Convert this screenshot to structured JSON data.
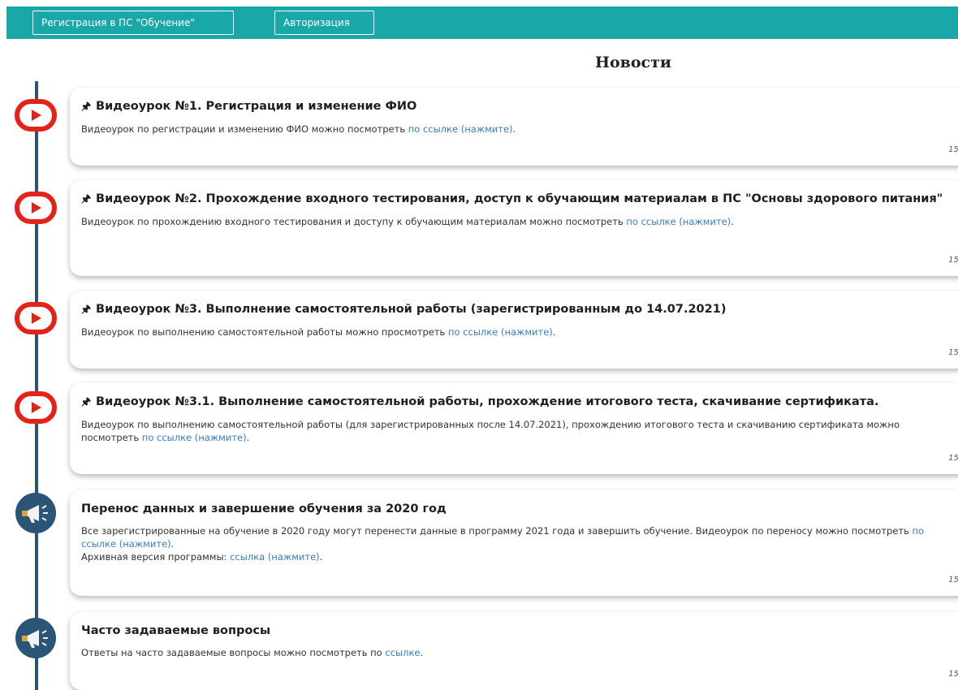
{
  "header": {
    "register_label": "Регистрация в ПС \"Обучение\"",
    "login_label": "Авторизация"
  },
  "page": {
    "title": "Новости"
  },
  "colors": {
    "topbar": "#1aa7a8",
    "timeline": "#2a5576",
    "youtube_red": "#e62117",
    "link": "#3a7bbf"
  },
  "news": [
    {
      "icon": "youtube-icon",
      "pinned": true,
      "title": "Видеоурок №1. Регистрация и изменение ФИО",
      "body_text": "Видеоурок по регистрации и изменению ФИО можно посмотреть ",
      "link_text": "по ссылке (нажмите)",
      "body_end": ".",
      "date": "15."
    },
    {
      "icon": "youtube-icon",
      "pinned": true,
      "title": "Видеоурок №2. Прохождение входного тестирования, доступ к обучающим материалам в ПС \"Основы здорового питания\"",
      "body_text": "Видеоурок по прохождению входного тестирования и доступу к обучающим материалам можно посмотреть ",
      "link_text": "по ссылке (нажмите)",
      "body_end": ".",
      "date": "15."
    },
    {
      "icon": "youtube-icon",
      "pinned": true,
      "title": "Видеоурок №3. Выполнение самостоятельной работы (зарегистрированным до 14.07.2021)",
      "body_text": "Видеоурок по выполнению самостоятельной работы можно просмотреть ",
      "link_text": "по ссылке (нажмите)",
      "body_end": ".",
      "date": "15."
    },
    {
      "icon": "youtube-icon",
      "pinned": true,
      "title": "Видеоурок №3.1. Выполнение самостоятельной работы, прохождение итогового теста, скачивание сертификата.",
      "body_text": "Видеоурок по выполнению самостоятельной работы (для зарегистрированных после 14.07.2021), прохождению итогового теста и скачиванию сертификата можно посмотреть ",
      "link_text": "по ссылке (нажмите)",
      "body_end": ".",
      "date": "15."
    },
    {
      "icon": "megaphone-icon",
      "pinned": false,
      "title": "Перенос данных и завершение обучения за 2020 год",
      "body_text": "Все зарегистрированные на обучение в 2020 году могут перенести данные в программу 2021 года и завершить обучение. Видеоурок по переносу можно посмотреть ",
      "link_text": "по ссылке (нажмите)",
      "body_end": ".",
      "extra_text": "Архивная версия программы: ",
      "extra_link": "ссылка (нажмите)",
      "extra_end": ".",
      "date": "15."
    },
    {
      "icon": "megaphone-icon",
      "pinned": false,
      "title": "Часто задаваемые вопросы",
      "body_text": "Ответы на часто задаваемые вопросы можно посмотреть по ",
      "link_text": "ссылке",
      "body_end": ".",
      "date": "15."
    }
  ]
}
